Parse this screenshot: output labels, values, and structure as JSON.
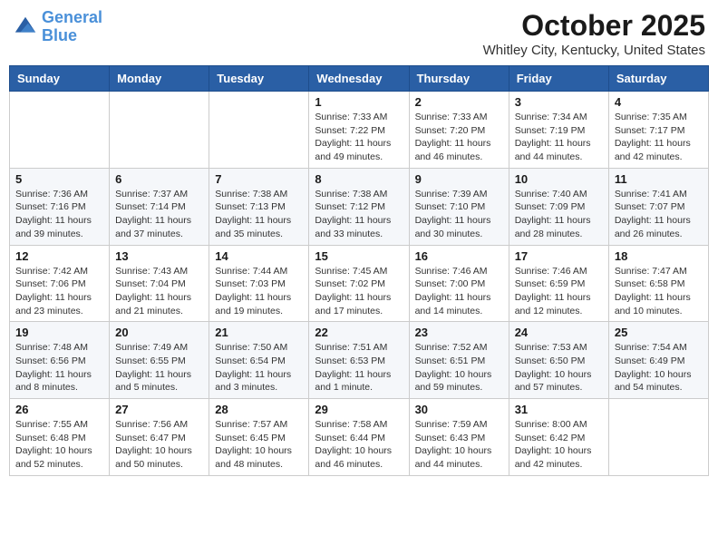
{
  "header": {
    "logo_line1": "General",
    "logo_line2": "Blue",
    "month": "October 2025",
    "location": "Whitley City, Kentucky, United States"
  },
  "weekdays": [
    "Sunday",
    "Monday",
    "Tuesday",
    "Wednesday",
    "Thursday",
    "Friday",
    "Saturday"
  ],
  "weeks": [
    [
      {
        "day": "",
        "info": ""
      },
      {
        "day": "",
        "info": ""
      },
      {
        "day": "",
        "info": ""
      },
      {
        "day": "1",
        "info": "Sunrise: 7:33 AM\nSunset: 7:22 PM\nDaylight: 11 hours\nand 49 minutes."
      },
      {
        "day": "2",
        "info": "Sunrise: 7:33 AM\nSunset: 7:20 PM\nDaylight: 11 hours\nand 46 minutes."
      },
      {
        "day": "3",
        "info": "Sunrise: 7:34 AM\nSunset: 7:19 PM\nDaylight: 11 hours\nand 44 minutes."
      },
      {
        "day": "4",
        "info": "Sunrise: 7:35 AM\nSunset: 7:17 PM\nDaylight: 11 hours\nand 42 minutes."
      }
    ],
    [
      {
        "day": "5",
        "info": "Sunrise: 7:36 AM\nSunset: 7:16 PM\nDaylight: 11 hours\nand 39 minutes."
      },
      {
        "day": "6",
        "info": "Sunrise: 7:37 AM\nSunset: 7:14 PM\nDaylight: 11 hours\nand 37 minutes."
      },
      {
        "day": "7",
        "info": "Sunrise: 7:38 AM\nSunset: 7:13 PM\nDaylight: 11 hours\nand 35 minutes."
      },
      {
        "day": "8",
        "info": "Sunrise: 7:38 AM\nSunset: 7:12 PM\nDaylight: 11 hours\nand 33 minutes."
      },
      {
        "day": "9",
        "info": "Sunrise: 7:39 AM\nSunset: 7:10 PM\nDaylight: 11 hours\nand 30 minutes."
      },
      {
        "day": "10",
        "info": "Sunrise: 7:40 AM\nSunset: 7:09 PM\nDaylight: 11 hours\nand 28 minutes."
      },
      {
        "day": "11",
        "info": "Sunrise: 7:41 AM\nSunset: 7:07 PM\nDaylight: 11 hours\nand 26 minutes."
      }
    ],
    [
      {
        "day": "12",
        "info": "Sunrise: 7:42 AM\nSunset: 7:06 PM\nDaylight: 11 hours\nand 23 minutes."
      },
      {
        "day": "13",
        "info": "Sunrise: 7:43 AM\nSunset: 7:04 PM\nDaylight: 11 hours\nand 21 minutes."
      },
      {
        "day": "14",
        "info": "Sunrise: 7:44 AM\nSunset: 7:03 PM\nDaylight: 11 hours\nand 19 minutes."
      },
      {
        "day": "15",
        "info": "Sunrise: 7:45 AM\nSunset: 7:02 PM\nDaylight: 11 hours\nand 17 minutes."
      },
      {
        "day": "16",
        "info": "Sunrise: 7:46 AM\nSunset: 7:00 PM\nDaylight: 11 hours\nand 14 minutes."
      },
      {
        "day": "17",
        "info": "Sunrise: 7:46 AM\nSunset: 6:59 PM\nDaylight: 11 hours\nand 12 minutes."
      },
      {
        "day": "18",
        "info": "Sunrise: 7:47 AM\nSunset: 6:58 PM\nDaylight: 11 hours\nand 10 minutes."
      }
    ],
    [
      {
        "day": "19",
        "info": "Sunrise: 7:48 AM\nSunset: 6:56 PM\nDaylight: 11 hours\nand 8 minutes."
      },
      {
        "day": "20",
        "info": "Sunrise: 7:49 AM\nSunset: 6:55 PM\nDaylight: 11 hours\nand 5 minutes."
      },
      {
        "day": "21",
        "info": "Sunrise: 7:50 AM\nSunset: 6:54 PM\nDaylight: 11 hours\nand 3 minutes."
      },
      {
        "day": "22",
        "info": "Sunrise: 7:51 AM\nSunset: 6:53 PM\nDaylight: 11 hours\nand 1 minute."
      },
      {
        "day": "23",
        "info": "Sunrise: 7:52 AM\nSunset: 6:51 PM\nDaylight: 10 hours\nand 59 minutes."
      },
      {
        "day": "24",
        "info": "Sunrise: 7:53 AM\nSunset: 6:50 PM\nDaylight: 10 hours\nand 57 minutes."
      },
      {
        "day": "25",
        "info": "Sunrise: 7:54 AM\nSunset: 6:49 PM\nDaylight: 10 hours\nand 54 minutes."
      }
    ],
    [
      {
        "day": "26",
        "info": "Sunrise: 7:55 AM\nSunset: 6:48 PM\nDaylight: 10 hours\nand 52 minutes."
      },
      {
        "day": "27",
        "info": "Sunrise: 7:56 AM\nSunset: 6:47 PM\nDaylight: 10 hours\nand 50 minutes."
      },
      {
        "day": "28",
        "info": "Sunrise: 7:57 AM\nSunset: 6:45 PM\nDaylight: 10 hours\nand 48 minutes."
      },
      {
        "day": "29",
        "info": "Sunrise: 7:58 AM\nSunset: 6:44 PM\nDaylight: 10 hours\nand 46 minutes."
      },
      {
        "day": "30",
        "info": "Sunrise: 7:59 AM\nSunset: 6:43 PM\nDaylight: 10 hours\nand 44 minutes."
      },
      {
        "day": "31",
        "info": "Sunrise: 8:00 AM\nSunset: 6:42 PM\nDaylight: 10 hours\nand 42 minutes."
      },
      {
        "day": "",
        "info": ""
      }
    ]
  ]
}
